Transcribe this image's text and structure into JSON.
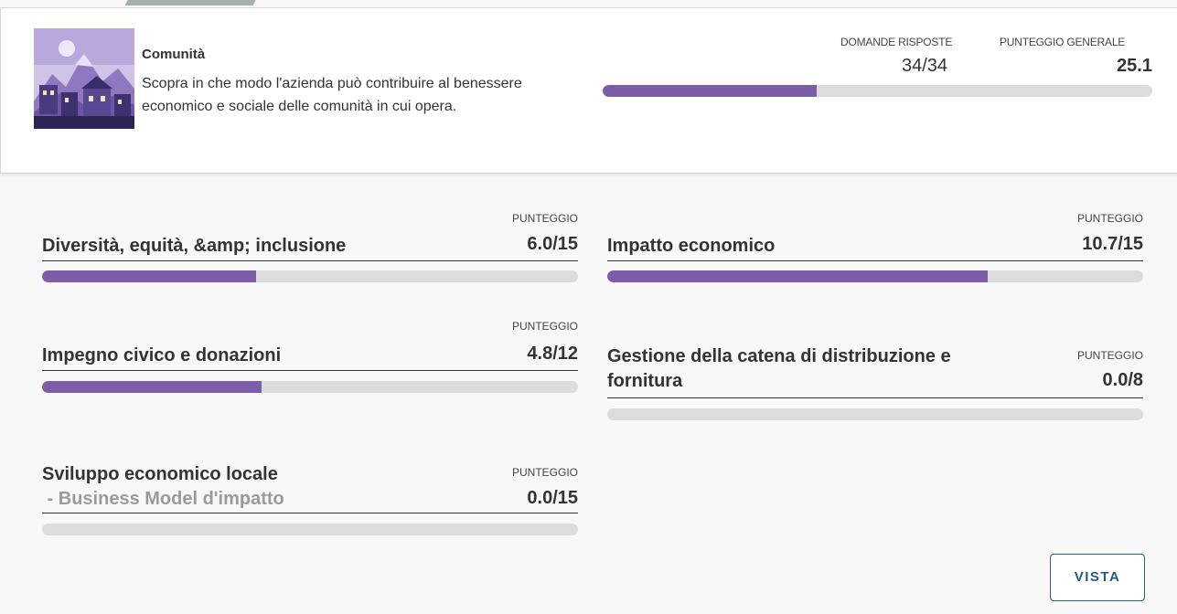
{
  "category": {
    "title": "Comunità",
    "description": "Scopra in che modo l'azienda può contribuire al benessere economico e sociale delle comunità in cui opera.",
    "image_icon": "community-illustration",
    "questions_label": "DOMANDE RISPOSTE",
    "questions_value": "34/34",
    "overall_label": "PUNTEGGIO GENERALE",
    "overall_value": "25.1",
    "overall_progress": 0.39
  },
  "subcategories": [
    {
      "name": "Diversità, equità, &amp; inclusione",
      "score_label": "PUNTEGGIO",
      "score": "6.0/15",
      "progress": 0.4
    },
    {
      "name": "Impatto economico",
      "score_label": "PUNTEGGIO",
      "score": "10.7/15",
      "progress": 0.71
    },
    {
      "name": "Impegno civico e donazioni",
      "score_label": "PUNTEGGIO",
      "score": "4.8/12",
      "progress": 0.41
    },
    {
      "name_line1": "Gestione della catena di distribuzione e",
      "name_line2": "fornitura",
      "score_label": "PUNTEGGIO",
      "score": "0.0/8",
      "progress": 0
    },
    {
      "name_line1": "Sviluppo economico locale",
      "name_line2": " - Business Model d'impatto",
      "score_label": "PUNTEGGIO",
      "score": "0.0/15",
      "progress": 0
    }
  ],
  "actions": {
    "view_label": "VISTA"
  },
  "colors": {
    "accent": "#7b5ea7",
    "track": "#dcdcdc",
    "button_text": "#1f5a84"
  }
}
